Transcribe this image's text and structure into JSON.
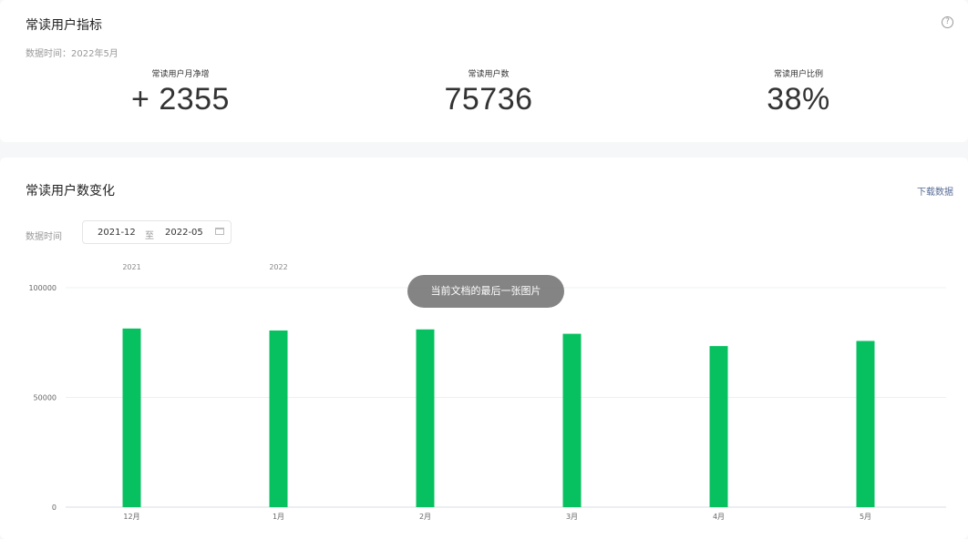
{
  "metrics_card": {
    "title": "常读用户指标",
    "help_icon": "?",
    "data_time": "数据时间：2022年5月",
    "metrics": [
      {
        "label": "常读用户月净增",
        "value": "+ 2355"
      },
      {
        "label": "常读用户数",
        "value": "75736"
      },
      {
        "label": "常读用户比例",
        "value": "38%"
      }
    ]
  },
  "trend_card": {
    "title": "常读用户数变化",
    "download_label": "下载数据",
    "filter_label": "数据时间",
    "date_start": "2021-12",
    "date_sep": "至",
    "date_end": "2022-05"
  },
  "toast": "当前文档的最后一张图片",
  "colors": {
    "bar": "#07c160",
    "grid": "#eef0f3"
  },
  "chart_data": {
    "type": "bar",
    "categories": [
      "12月",
      "1月",
      "2月",
      "3月",
      "4月",
      "5月"
    ],
    "year_labels": [
      "2021",
      "2022"
    ],
    "values": [
      81400,
      80500,
      81000,
      79000,
      73400,
      75736
    ],
    "ylim": [
      0,
      100000
    ],
    "yticks": [
      "0",
      "50000",
      "100000"
    ],
    "grid": true
  }
}
